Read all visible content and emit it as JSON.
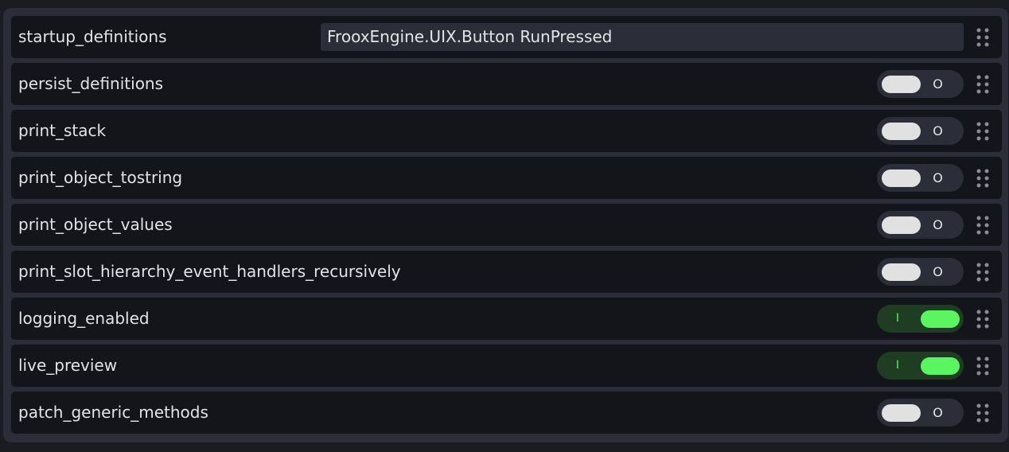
{
  "colors": {
    "background": "#1a1c22",
    "panel": "#2b2e38",
    "row": "#13151b",
    "text": "#e3e3e8",
    "toggle_on_track": "#1e3d22",
    "toggle_on_knob": "#5af560",
    "toggle_off_knob": "#e1e1e1"
  },
  "icons": {
    "drag_handle": "drag-handle-icon"
  },
  "toggle_marks": {
    "on": "I",
    "off": "O"
  },
  "settings": [
    {
      "key": "startup_definitions",
      "label": "startup_definitions",
      "type": "text",
      "value": "FrooxEngine.UIX.Button RunPressed"
    },
    {
      "key": "persist_definitions",
      "label": "persist_definitions",
      "type": "toggle",
      "value": false
    },
    {
      "key": "print_stack",
      "label": "print_stack",
      "type": "toggle",
      "value": false
    },
    {
      "key": "print_object_tostring",
      "label": "print_object_tostring",
      "type": "toggle",
      "value": false
    },
    {
      "key": "print_object_values",
      "label": "print_object_values",
      "type": "toggle",
      "value": false
    },
    {
      "key": "print_slot_hierarchy_event_handlers_recursively",
      "label": "print_slot_hierarchy_event_handlers_recursively",
      "type": "toggle",
      "value": false
    },
    {
      "key": "logging_enabled",
      "label": "logging_enabled",
      "type": "toggle",
      "value": true
    },
    {
      "key": "live_preview",
      "label": "live_preview",
      "type": "toggle",
      "value": true
    },
    {
      "key": "patch_generic_methods",
      "label": "patch_generic_methods",
      "type": "toggle",
      "value": false
    }
  ]
}
